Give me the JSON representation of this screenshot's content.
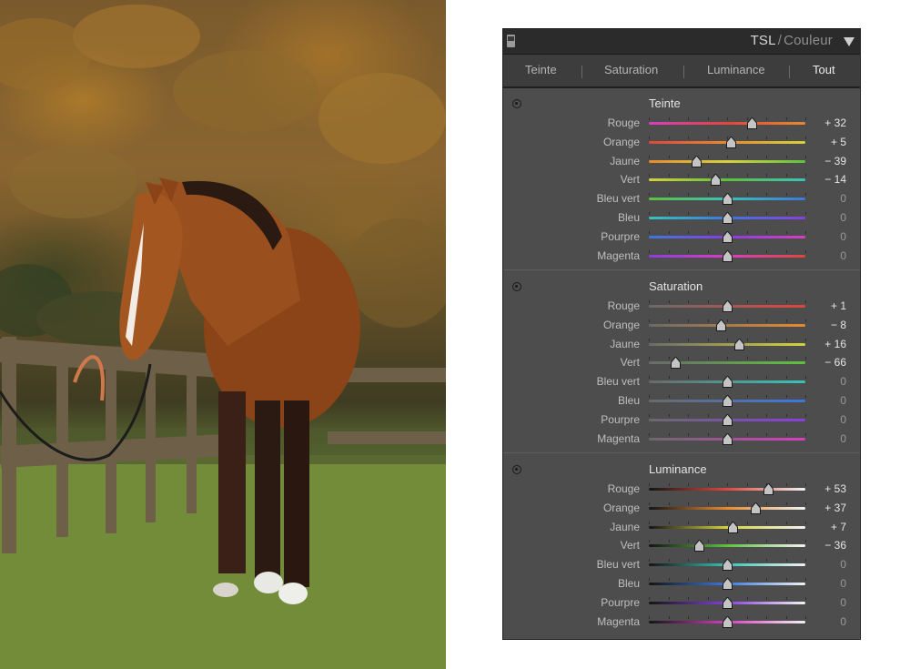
{
  "photo": {
    "alt_name": "horse-photo"
  },
  "panel": {
    "title_main": "TSL",
    "title_sep": "/",
    "title_sub": "Couleur",
    "tabs": [
      {
        "label": "Teinte",
        "active": false
      },
      {
        "label": "Saturation",
        "active": false
      },
      {
        "label": "Luminance",
        "active": false
      },
      {
        "label": "Tout",
        "active": true
      }
    ],
    "sections": [
      {
        "title": "Teinte",
        "kind": "hue",
        "rows": [
          {
            "label": "Rouge",
            "value": 32,
            "display": "+ 32"
          },
          {
            "label": "Orange",
            "value": 5,
            "display": "+ 5"
          },
          {
            "label": "Jaune",
            "value": -39,
            "display": "− 39"
          },
          {
            "label": "Vert",
            "value": -14,
            "display": "− 14"
          },
          {
            "label": "Bleu vert",
            "value": 0,
            "display": "0"
          },
          {
            "label": "Bleu",
            "value": 0,
            "display": "0"
          },
          {
            "label": "Pourpre",
            "value": 0,
            "display": "0"
          },
          {
            "label": "Magenta",
            "value": 0,
            "display": "0"
          }
        ]
      },
      {
        "title": "Saturation",
        "kind": "sat",
        "rows": [
          {
            "label": "Rouge",
            "value": 1,
            "display": "+ 1"
          },
          {
            "label": "Orange",
            "value": -8,
            "display": "− 8"
          },
          {
            "label": "Jaune",
            "value": 16,
            "display": "+ 16"
          },
          {
            "label": "Vert",
            "value": -66,
            "display": "− 66"
          },
          {
            "label": "Bleu vert",
            "value": 0,
            "display": "0"
          },
          {
            "label": "Bleu",
            "value": 0,
            "display": "0"
          },
          {
            "label": "Pourpre",
            "value": 0,
            "display": "0"
          },
          {
            "label": "Magenta",
            "value": 0,
            "display": "0"
          }
        ]
      },
      {
        "title": "Luminance",
        "kind": "lum",
        "rows": [
          {
            "label": "Rouge",
            "value": 53,
            "display": "+ 53"
          },
          {
            "label": "Orange",
            "value": 37,
            "display": "+ 37"
          },
          {
            "label": "Jaune",
            "value": 7,
            "display": "+ 7"
          },
          {
            "label": "Vert",
            "value": -36,
            "display": "− 36"
          },
          {
            "label": "Bleu vert",
            "value": 0,
            "display": "0"
          },
          {
            "label": "Bleu",
            "value": 0,
            "display": "0"
          },
          {
            "label": "Pourpre",
            "value": 0,
            "display": "0"
          },
          {
            "label": "Magenta",
            "value": 0,
            "display": "0"
          }
        ]
      }
    ],
    "slider_range": [
      -100,
      100
    ],
    "colors": {
      "rouge": "#e0463e",
      "orange": "#e88a2e",
      "jaune": "#d6d23a",
      "vert": "#5ec23e",
      "bleu_vert": "#36c4b8",
      "bleu": "#3c78e0",
      "pourpre": "#8a3ee0",
      "magenta": "#d83ec0"
    }
  }
}
